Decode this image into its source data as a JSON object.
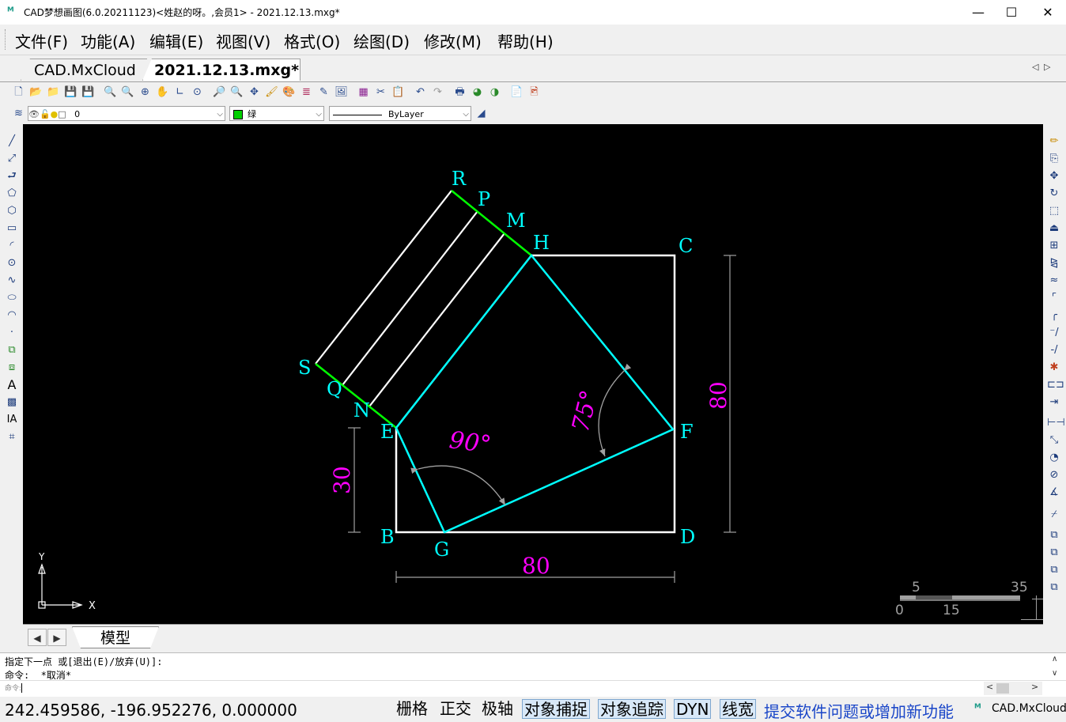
{
  "window": {
    "title": "CAD梦想画图(6.0.20211123)<姓赵的呀。,会员1> - 2021.12.13.mxg*",
    "minimize": "—",
    "maximize": "☐",
    "close": "✕"
  },
  "menu": {
    "items": [
      "文件(F)",
      "功能(A)",
      "编辑(E)",
      "视图(V)",
      "格式(O)",
      "绘图(D)",
      "修改(M)",
      "帮助(H)"
    ]
  },
  "tabs": {
    "items": [
      "CAD.MxCloud",
      "2021.12.13.mxg*"
    ],
    "nav_left": "◁",
    "nav_right": "▷"
  },
  "layer_bar": {
    "layer": "0",
    "color": "绿",
    "linetype": "ByLayer"
  },
  "drawing": {
    "point_labels": {
      "R": "R",
      "P": "P",
      "M": "M",
      "H": "H",
      "C": "C",
      "S": "S",
      "Q": "Q",
      "N": "N",
      "E": "E",
      "F": "F",
      "B": "B",
      "G": "G",
      "D": "D"
    },
    "dimensions": {
      "bottom": "80",
      "right": "80",
      "left": "30",
      "angle_g": "90°",
      "angle_f": "75°"
    },
    "ucs": {
      "x": "X",
      "y": "Y"
    },
    "scale": {
      "label_5": "5",
      "label_35": "35",
      "label_0": "0",
      "label_15": "15"
    },
    "colors": {
      "cyan": "#00ffff",
      "magenta": "#ff00ff",
      "green": "#00ff00",
      "white": "#ffffff",
      "gray": "#a0a0a0"
    }
  },
  "model_tabs": {
    "prev": "◀",
    "next": "▶",
    "model": "模型"
  },
  "command": {
    "line1": "指定下一点 或[退出(E)/放弃(U)]:",
    "line2": "命令:  *取消*",
    "prompt": "命令:"
  },
  "status": {
    "coords": "242.459586,  -196.952276,  0.000000",
    "grid": "栅格",
    "ortho": "正交",
    "polar": "极轴",
    "osnap": "对象捕捉",
    "otrack": "对象追踪",
    "dyn": "DYN",
    "lineweight": "线宽",
    "feedback": "提交软件问题或增加新功能",
    "brand": "CAD.MxCloud"
  }
}
